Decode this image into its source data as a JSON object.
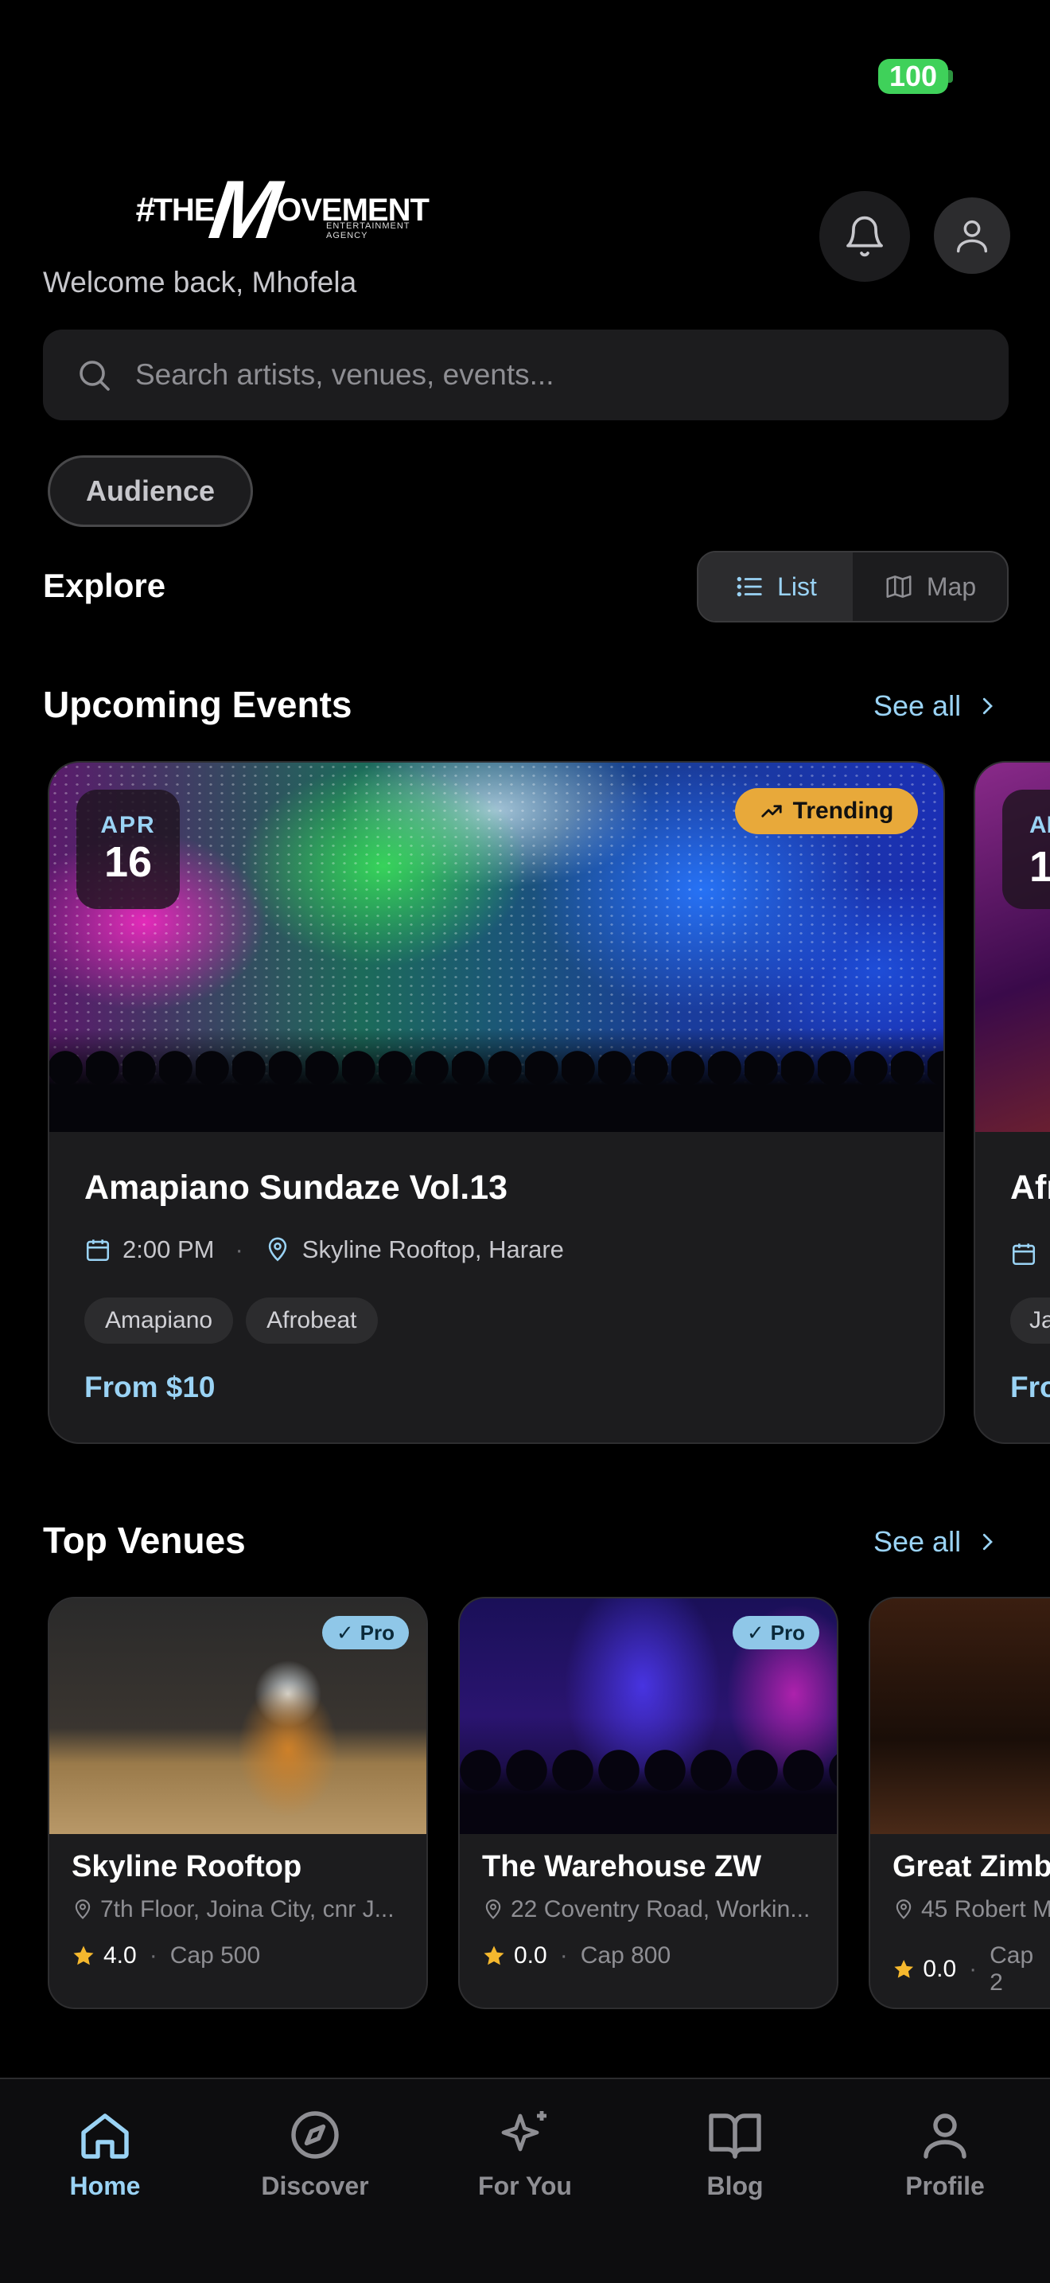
{
  "status": {
    "battery": "100"
  },
  "header": {
    "logo_hash": "#",
    "logo_the": "THE",
    "logo_m": "M",
    "logo_rest": "OVEMENT",
    "logo_sub": "ENTERTAINMENT AGENCY",
    "welcome": "Welcome back, Mhofela"
  },
  "search": {
    "placeholder": "Search artists, venues, events..."
  },
  "audience_chip": "Audience",
  "explore": {
    "title": "Explore",
    "toggle": {
      "list": "List",
      "map": "Map",
      "selected": "List"
    }
  },
  "upcoming": {
    "title": "Upcoming Events",
    "see_all": "See all",
    "events": [
      {
        "month": "APR",
        "day": "16",
        "badge": "Trending",
        "title": "Amapiano Sundaze Vol.13",
        "time": "2:00 PM",
        "venue": "Skyline Rooftop, Harare",
        "tags": [
          "Amapiano",
          "Afrobeat"
        ],
        "price": "From $10"
      },
      {
        "month": "AP",
        "day": "1",
        "title": "Afr",
        "tags": [
          "Ja"
        ],
        "price": "Fro"
      }
    ]
  },
  "venues": {
    "title": "Top Venues",
    "see_all": "See all",
    "items": [
      {
        "name": "Skyline Rooftop",
        "address": "7th Floor, Joina City, cnr J...",
        "rating": "4.0",
        "capacity": "Cap 500",
        "pro": "Pro"
      },
      {
        "name": "The Warehouse ZW",
        "address": "22 Coventry Road, Workin...",
        "rating": "0.0",
        "capacity": "Cap 800",
        "pro": "Pro"
      },
      {
        "name": "Great Zimb",
        "address": "45 Robert M",
        "rating": "0.0",
        "capacity": "Cap 2"
      }
    ]
  },
  "tabbar": {
    "tabs": [
      {
        "label": "Home",
        "icon": "home-icon",
        "active": true
      },
      {
        "label": "Discover",
        "icon": "compass-icon"
      },
      {
        "label": "For You",
        "icon": "sparkles-icon"
      },
      {
        "label": "Blog",
        "icon": "book-icon"
      },
      {
        "label": "Profile",
        "icon": "person-icon"
      }
    ]
  },
  "colors": {
    "accent": "#9ad3f5",
    "trending": "#e8a93a",
    "star": "#f5b82e",
    "battery": "#3fd15a"
  }
}
